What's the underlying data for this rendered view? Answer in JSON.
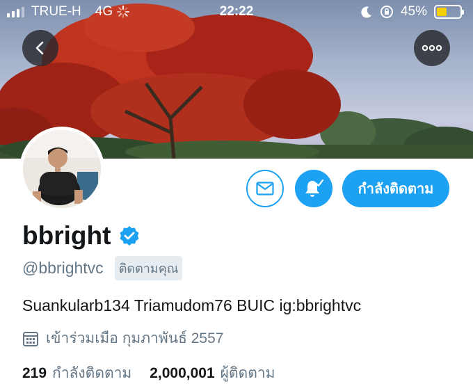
{
  "status_bar": {
    "carrier": "TRUE-H",
    "network": "4G",
    "time": "22:22",
    "battery": "45%",
    "battery_level": 0.45
  },
  "icons": {
    "back": "chevron-left-icon",
    "more": "more-horizontal-icon",
    "message": "envelope-icon",
    "notifications": "bell-icon",
    "verified": "verified-badge-icon",
    "calendar": "calendar-icon"
  },
  "profile": {
    "display_name": "bbright",
    "handle": "@bbrightvc",
    "follows_you": "ติดตามคุณ",
    "bio": "Suankularb134 Triamudom76 BUIC ig:bbrightvc",
    "joined": "เข้าร่วมเมือ กุมภาพันธ์ 2557",
    "following_count": "219",
    "following_label": "กำลังติดตาม",
    "followers_count": "2,000,001",
    "followers_label": "ผู้ติดตาม"
  },
  "actions": {
    "following_button": "กำลังติดตาม"
  },
  "colors": {
    "accent": "#1da1f2",
    "text_primary": "#14171a",
    "text_secondary": "#657786"
  }
}
